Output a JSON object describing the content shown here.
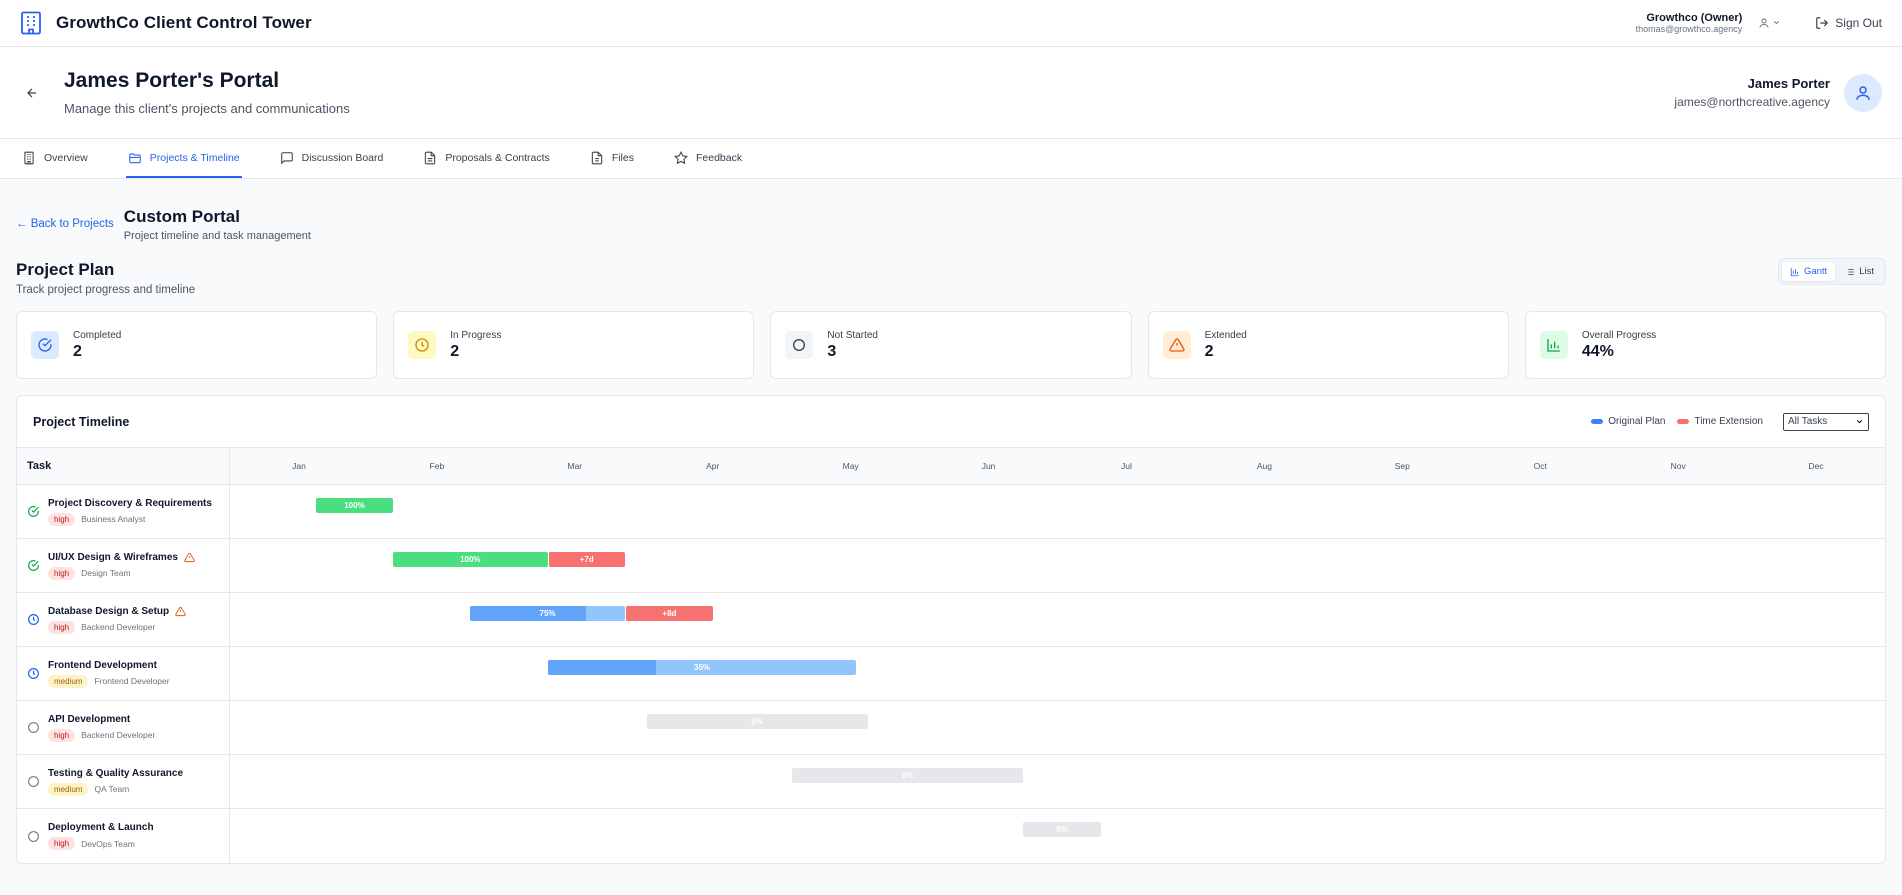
{
  "app": {
    "title": "GrowthCo Client Control Tower",
    "account_org": "Growthco (Owner)",
    "account_email": "thomas@growthco.agency",
    "sign_out": "Sign Out"
  },
  "portal": {
    "title": "James Porter's Portal",
    "subtitle": "Manage this client's projects and communications",
    "client_name": "James Porter",
    "client_email": "james@northcreative.agency"
  },
  "tabs": [
    {
      "label": "Overview",
      "icon": "building-icon",
      "active": false
    },
    {
      "label": "Projects & Timeline",
      "icon": "folder-icon",
      "active": true
    },
    {
      "label": "Discussion Board",
      "icon": "chat-icon",
      "active": false
    },
    {
      "label": "Proposals & Contracts",
      "icon": "document-icon",
      "active": false
    },
    {
      "label": "Files",
      "icon": "file-icon",
      "active": false
    },
    {
      "label": "Feedback",
      "icon": "star-icon",
      "active": false
    }
  ],
  "project": {
    "back_label": "← Back to Projects",
    "title": "Custom Portal",
    "subtitle": "Project timeline and task management"
  },
  "plan": {
    "title": "Project Plan",
    "subtitle": "Track project progress and timeline",
    "view_gantt": "Gantt",
    "view_list": "List"
  },
  "stats": [
    {
      "label": "Completed",
      "value": "2",
      "icon": "check-circle-icon",
      "bg": "#dbeafe",
      "color": "#2563eb"
    },
    {
      "label": "In Progress",
      "value": "2",
      "icon": "clock-icon",
      "bg": "#fef9c3",
      "color": "#ca8a04"
    },
    {
      "label": "Not Started",
      "value": "3",
      "icon": "circle-icon",
      "bg": "#f3f4f6",
      "color": "#374151"
    },
    {
      "label": "Extended",
      "value": "2",
      "icon": "warning-icon",
      "bg": "#ffedd5",
      "color": "#ea580c"
    },
    {
      "label": "Overall Progress",
      "value": "44%",
      "icon": "bar-chart-icon",
      "bg": "#dcfce7",
      "color": "#16a34a"
    }
  ],
  "timeline": {
    "title": "Project Timeline",
    "legend_original": "Original Plan",
    "legend_extension": "Time Extension",
    "filter_value": "All Tasks",
    "task_header": "Task",
    "months": [
      "Jan",
      "Feb",
      "Mar",
      "Apr",
      "May",
      "Jun",
      "Jul",
      "Aug",
      "Sep",
      "Oct",
      "Nov",
      "Dec"
    ],
    "colors": {
      "completed": "#4ade80",
      "in_progress_fill": "#60a5fa",
      "in_progress_rest": "#93c5fd",
      "not_started": "#e5e7eb",
      "extension": "#f87171"
    },
    "tasks": [
      {
        "name": "Project Discovery & Requirements",
        "priority": "high",
        "role": "Business Analyst",
        "status": "completed",
        "warning": false,
        "start_month": 0.55,
        "duration_months": 0.56,
        "progress": 100,
        "progress_label": "100%",
        "extension_months": 0,
        "extension_label": ""
      },
      {
        "name": "UI/UX Design & Wireframes",
        "priority": "high",
        "role": "Design Team",
        "status": "completed",
        "warning": true,
        "start_month": 1.11,
        "duration_months": 1.12,
        "progress": 100,
        "progress_label": "100%",
        "extension_months": 0.56,
        "extension_label": "+7d"
      },
      {
        "name": "Database Design & Setup",
        "priority": "high",
        "role": "Backend Developer",
        "status": "in_progress",
        "warning": true,
        "start_month": 1.67,
        "duration_months": 1.12,
        "progress": 75,
        "progress_label": "75%",
        "extension_months": 0.64,
        "extension_label": "+8d"
      },
      {
        "name": "Frontend Development",
        "priority": "medium",
        "role": "Frontend Developer",
        "status": "in_progress",
        "warning": false,
        "start_month": 2.23,
        "duration_months": 2.24,
        "progress": 35,
        "progress_label": "35%",
        "extension_months": 0,
        "extension_label": ""
      },
      {
        "name": "API Development",
        "priority": "high",
        "role": "Backend Developer",
        "status": "not_started",
        "warning": false,
        "start_month": 2.95,
        "duration_months": 1.6,
        "progress": 0,
        "progress_label": "0%",
        "extension_months": 0,
        "extension_label": ""
      },
      {
        "name": "Testing & Quality Assurance",
        "priority": "medium",
        "role": "QA Team",
        "status": "not_started",
        "warning": false,
        "start_month": 4.0,
        "duration_months": 1.68,
        "progress": 0,
        "progress_label": "0%",
        "extension_months": 0,
        "extension_label": ""
      },
      {
        "name": "Deployment & Launch",
        "priority": "high",
        "role": "DevOps Team",
        "status": "not_started",
        "warning": false,
        "start_month": 5.68,
        "duration_months": 0.56,
        "progress": 0,
        "progress_label": "0%",
        "extension_months": 0,
        "extension_label": ""
      }
    ]
  }
}
